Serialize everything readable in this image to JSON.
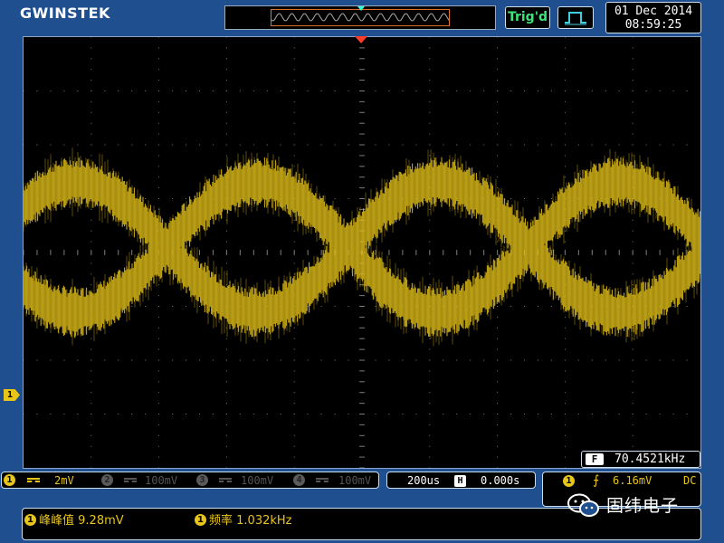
{
  "header": {
    "logo": "GWINSTEK",
    "trigger_status": "Trig'd",
    "date": "01 Dec 2014",
    "time": "08:59:25",
    "acquire_icon": "square-pulse-icon"
  },
  "display": {
    "frequency_counter_tag": "F",
    "frequency_counter": "70.4521kHz",
    "channel_marker": "1"
  },
  "channels": [
    {
      "num": "1",
      "coupling": "DC",
      "scale": "2mV",
      "active": true
    },
    {
      "num": "2",
      "coupling": "DC",
      "scale": "100mV",
      "active": false
    },
    {
      "num": "3",
      "coupling": "DC",
      "scale": "100mV",
      "active": false
    },
    {
      "num": "4",
      "coupling": "DC",
      "scale": "100mV",
      "active": false
    }
  ],
  "timebase": {
    "scale": "200us",
    "icon_label": "H",
    "position": "0.000s"
  },
  "trigger": {
    "source": "1",
    "slope": "rising-edge-icon",
    "slope_glyph": "⨍",
    "level": "6.16mV",
    "coupling": "DC"
  },
  "measurements": [
    {
      "source": "1",
      "label": "峰峰值",
      "value": "9.28mV"
    },
    {
      "source": "1",
      "label": "频率",
      "value": "1.032kHz"
    }
  ],
  "watermark": {
    "text": "固纬电子"
  },
  "colors": {
    "trace": "#e8c51a",
    "frame": "#1f4f8f",
    "trig_marker": "#ff3b2a",
    "trig_status": "#3fe37a"
  }
}
